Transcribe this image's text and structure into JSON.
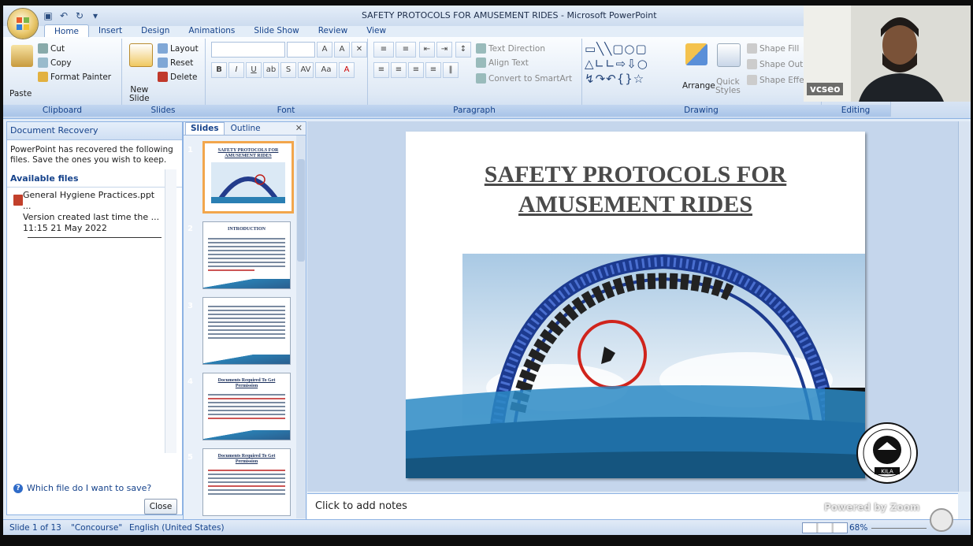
{
  "window": {
    "title": "SAFETY PROTOCOLS FOR AMUSEMENT RIDES - Microsoft PowerPoint"
  },
  "tabs": [
    "Home",
    "Insert",
    "Design",
    "Animations",
    "Slide Show",
    "Review",
    "View"
  ],
  "ribbon": {
    "clipboard": {
      "paste": "Paste",
      "cut": "Cut",
      "copy": "Copy",
      "format_painter": "Format Painter",
      "label": "Clipboard"
    },
    "slides": {
      "new_slide": "New",
      "new_slide2": "Slide",
      "layout": "Layout",
      "reset": "Reset",
      "delete": "Delete",
      "label": "Slides"
    },
    "font": {
      "label": "Font",
      "bold": "B",
      "italic": "I",
      "underline": "U",
      "aa": "Aa",
      "a": "A"
    },
    "paragraph": {
      "text_direction": "Text Direction",
      "align_text": "Align Text",
      "convert": "Convert to SmartArt",
      "label": "Paragraph"
    },
    "drawing": {
      "arrange": "Arrange",
      "quick_styles": "Quick",
      "quick_styles2": "Styles",
      "shape_fill": "Shape Fill",
      "shape_outline": "Shape Outline",
      "shape_effects": "Shape Effects",
      "label": "Drawing"
    },
    "editing": {
      "label": "Editing"
    }
  },
  "recovery": {
    "header": "Document Recovery",
    "message": "PowerPoint has recovered the following files. Save the ones you wish to keep.",
    "available": "Available files",
    "file_name": "General Hygiene Practices.ppt ...",
    "file_desc": "Version created last time the ...",
    "file_time": "11:15 21 May 2022",
    "help": "Which file do I want to save?",
    "close": "Close"
  },
  "slides_panel": {
    "tabs": [
      "Slides",
      "Outline"
    ],
    "thumbs": [
      {
        "num": "1",
        "title": "SAFETY PROTOCOLS FOR AMUSEMENT RIDES"
      },
      {
        "num": "2",
        "title": "INTRODUCTION"
      },
      {
        "num": "3",
        "title": ""
      },
      {
        "num": "4",
        "title": "Documents Required To Get Permission"
      },
      {
        "num": "5",
        "title": "Documents Required To Get Permission"
      }
    ]
  },
  "slide": {
    "title_line1": "SAFETY PROTOCOLS FOR",
    "title_line2": "AMUSEMENT RIDES"
  },
  "notes": {
    "placeholder": "Click to add notes"
  },
  "status": {
    "slide": "Slide 1 of 13",
    "theme": "\"Concourse\"",
    "language": "English (United States)",
    "zoom": "68%"
  },
  "webcam": {
    "name": "vcseo"
  },
  "overlay": {
    "brand": "Powered by Zoom",
    "logo_text": "KILA"
  }
}
